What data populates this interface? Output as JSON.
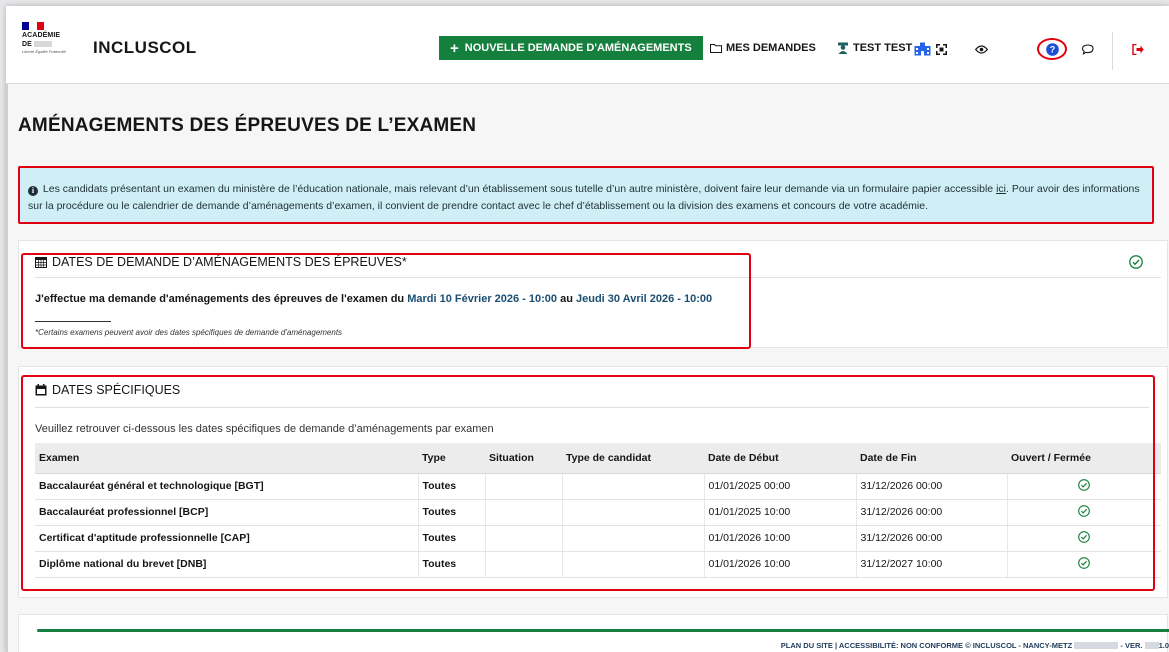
{
  "header": {
    "logo_line1": "ACADÉMIE",
    "logo_line2": "DE",
    "logo_motto": "Liberté Égalité Fraternité",
    "app_name": "INCLUSCOL",
    "new_request_label": "NOUVELLE DEMANDE D'AMÉNAGEMENTS",
    "my_requests_label": "MES DEMANDES",
    "user_label": "TEST TEST",
    "colors": {
      "brand_green": "#15803d",
      "marianne_blue": "#000091",
      "marianne_red": "#e1000f"
    }
  },
  "page": {
    "title": "AMÉNAGEMENTS DES ÉPREUVES DE L’EXAMEN"
  },
  "info_box": {
    "text_before_link": "Les candidats présentant un examen du ministère de l’éducation nationale, mais relevant d’un établissement sous tutelle d’un autre ministère, doivent faire leur demande via un formulaire papier accessible",
    "link_label": "ici",
    "text_after_link": ". Pour avoir des informations sur la procédure ou le calendrier de demande d’aménagements d’examen, il convient de prendre contact avec le chef d’établissement ou la division des examens et concours de votre académie.",
    "background": "#cfeef5"
  },
  "dates_section": {
    "title": "DATES DE DEMANDE D’AMÉNAGEMENTS DES ÉPREUVES*",
    "sentence_start": "J'effectue ma demande d'aménagements des épreuves de l'examen du",
    "start_date": "Mardi 10 Février 2026 - 10:00",
    "connector": "au",
    "end_date": "Jeudi 30 Avril 2026 - 10:00",
    "footnote": "*Certains examens peuvent avoir des dates spécifiques de demande d'aménagements"
  },
  "specific_section": {
    "title": "DATES SPÉCIFIQUES",
    "intro": "Veuillez retrouver ci-dessous les dates spécifiques de demande d’aménagements par examen",
    "columns": [
      "Examen",
      "Type",
      "Situation",
      "Type de candidat",
      "Date de Début",
      "Date de Fin",
      "Ouvert / Fermée"
    ],
    "rows": [
      {
        "examen": "Baccalauréat général et technologique [BGT]",
        "type": "Toutes",
        "situation": "",
        "type_candidat": "",
        "debut": "01/01/2025 00:00",
        "fin": "31/12/2026 00:00",
        "status_icon": "check-circle-icon"
      },
      {
        "examen": "Baccalauréat professionnel [BCP]",
        "type": "Toutes",
        "situation": "",
        "type_candidat": "",
        "debut": "01/01/2025 10:00",
        "fin": "31/12/2026 00:00",
        "status_icon": "check-circle-icon"
      },
      {
        "examen": "Certificat d'aptitude professionnelle [CAP]",
        "type": "Toutes",
        "situation": "",
        "type_candidat": "",
        "debut": "01/01/2026 10:00",
        "fin": "31/12/2026 00:00",
        "status_icon": "check-circle-icon"
      },
      {
        "examen": "Diplôme national du brevet [DNB]",
        "type": "Toutes",
        "situation": "",
        "type_candidat": "",
        "debut": "01/01/2026 10:00",
        "fin": "31/12/2027 10:00",
        "status_icon": "check-circle-icon"
      }
    ]
  },
  "footer": {
    "text_start": "PLAN DU SITE | ACCESSIBILITÉ: NON CONFORME © INCLUSCOL - NANCY-METZ",
    "version_label": "- VER.",
    "version_tail": "1.0"
  }
}
